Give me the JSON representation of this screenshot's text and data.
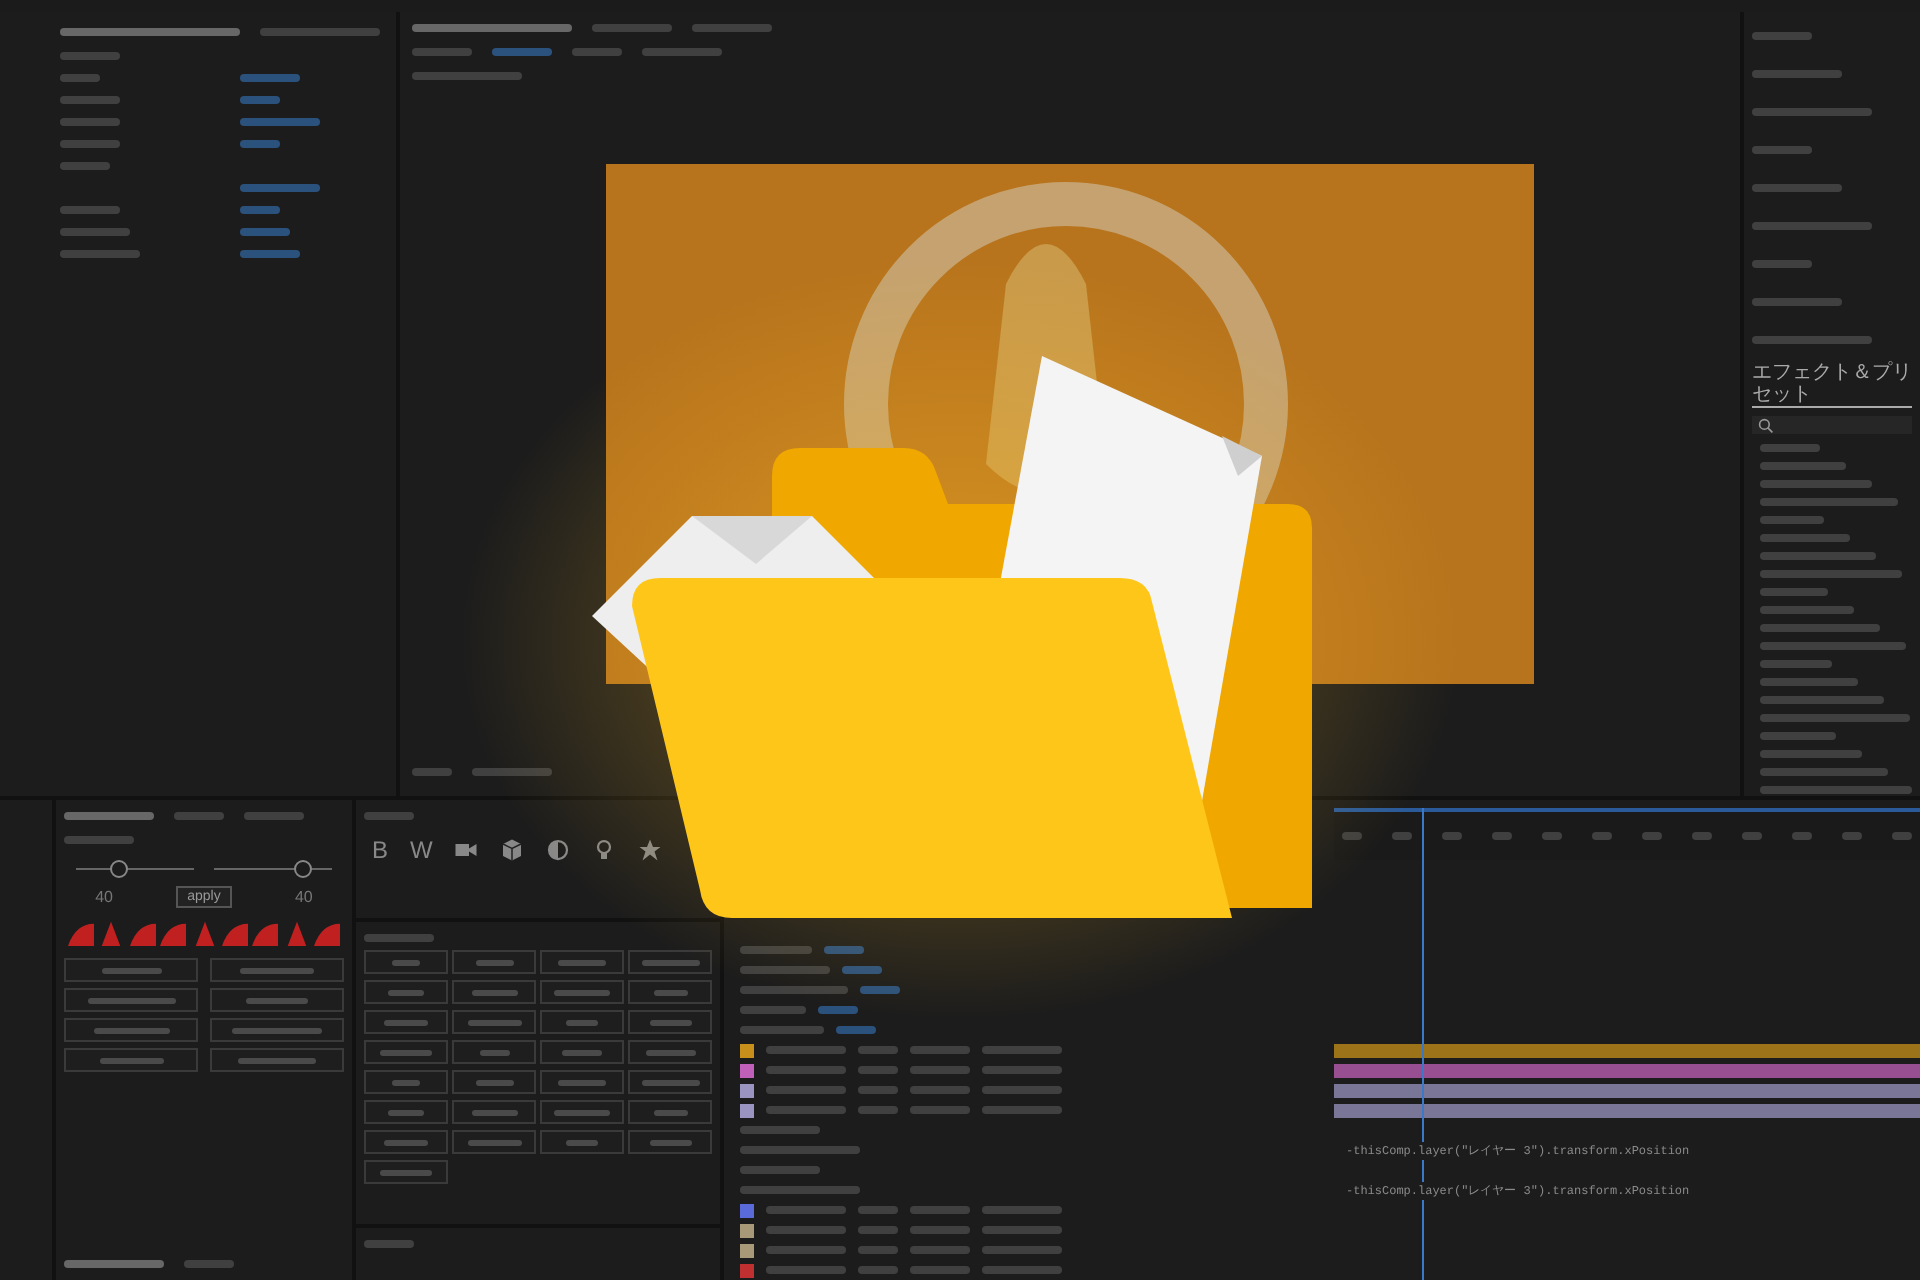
{
  "effects_panel": {
    "title": "エフェクト＆プリセット"
  },
  "keyframe_panel": {
    "sliders": [
      {
        "level": 0.35
      },
      {
        "level": 0.75
      }
    ],
    "readings": [
      "40",
      "40"
    ],
    "apply_button": "apply"
  },
  "tools_panel": {
    "letter_buttons": [
      "B",
      "W"
    ]
  },
  "timeline": {
    "layers": [
      {
        "color": "#c8901a"
      },
      {
        "color": "#c060b8"
      },
      {
        "color": "#9a94c0"
      },
      {
        "color": "#9a94c0"
      }
    ],
    "expressions": [
      "-thisComp.layer(\"レイヤー 3\").transform.xPosition",
      "-thisComp.layer(\"レイヤー 3\").transform.xPosition"
    ],
    "more_layers": [
      {
        "color": "#5a6ad8"
      },
      {
        "color": "#a89a78"
      },
      {
        "color": "#a89a78"
      },
      {
        "color": "#c03030"
      }
    ]
  }
}
